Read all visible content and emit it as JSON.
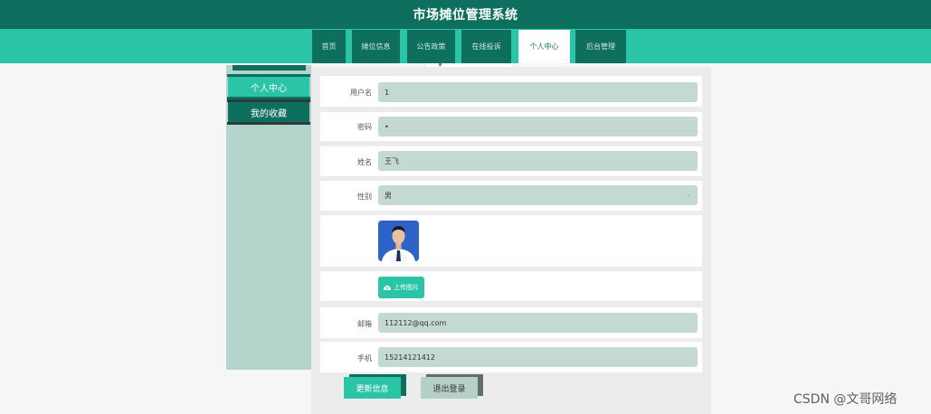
{
  "header": {
    "title": "市场摊位管理系统"
  },
  "nav": {
    "items": [
      {
        "label": "首页"
      },
      {
        "label": "摊位信息"
      },
      {
        "label": "公告政策"
      },
      {
        "label": "在线投诉"
      },
      {
        "label": "个人中心",
        "active": true
      },
      {
        "label": "后台管理"
      }
    ]
  },
  "sidebar": {
    "items": [
      {
        "label": "个人中心",
        "active": true
      },
      {
        "label": "我的收藏"
      }
    ]
  },
  "form": {
    "username": {
      "label": "用户名",
      "value": "1"
    },
    "password": {
      "label": "密码",
      "value": "•"
    },
    "name": {
      "label": "姓名",
      "value": "王飞"
    },
    "gender": {
      "label": "性别",
      "value": "男"
    },
    "avatar": {
      "icon": "profile-photo"
    },
    "upload": {
      "label": "上传图片",
      "icon": "cloud-upload-icon"
    },
    "email": {
      "label": "邮箱",
      "value": "112112@qq.com"
    },
    "phone": {
      "label": "手机",
      "value": "15214121412"
    }
  },
  "actions": {
    "update_label": "更新信息",
    "logout_label": "退出登录"
  },
  "watermark": {
    "text": "CSDN @文哥网络"
  },
  "colors": {
    "header_dark": "#0f6f5f",
    "accent": "#2ac5a6",
    "field_bg": "#c5d9d4",
    "sidebar_bg": "#b4d4cc"
  }
}
